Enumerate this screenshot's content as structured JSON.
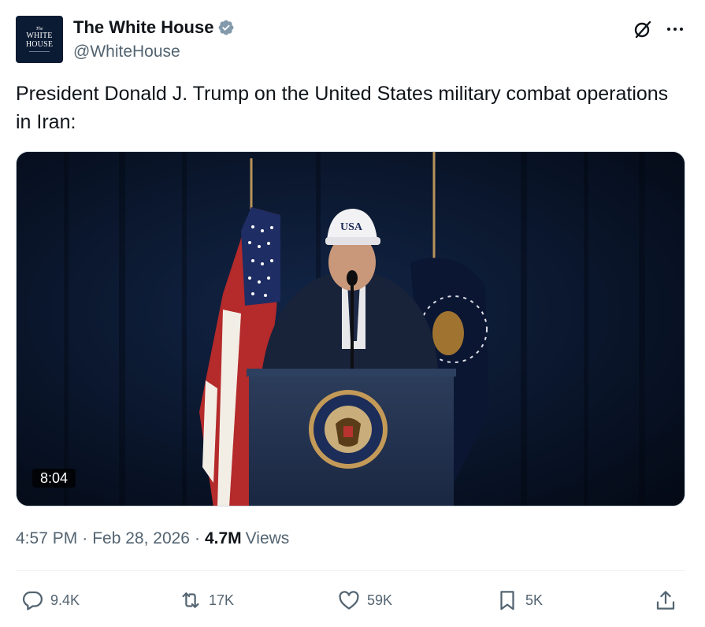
{
  "author": {
    "display_name": "The White House",
    "handle": "@WhiteHouse",
    "verified": true,
    "avatar_text": {
      "the": "The",
      "line1": "WHITE",
      "line2": "HOUSE"
    }
  },
  "header_icons": {
    "grok": "grok-icon",
    "more": "more-icon"
  },
  "tweet": {
    "text": "President Donald J. Trump on the United States military combat operations in Iran:",
    "media": {
      "duration": "8:04",
      "description_icons": {
        "cap_text": "USA"
      }
    },
    "time": "4:57 PM",
    "date": "Feb 28, 2026",
    "dot": "·",
    "views_count": "4.7M",
    "views_label": "Views"
  },
  "actions": {
    "replies": "9.4K",
    "reposts": "17K",
    "likes": "59K",
    "bookmarks": "5K"
  },
  "colors": {
    "text_primary": "#0f1419",
    "text_secondary": "#536471",
    "verified_badge": "#829aab",
    "divider": "#eff3f4"
  }
}
